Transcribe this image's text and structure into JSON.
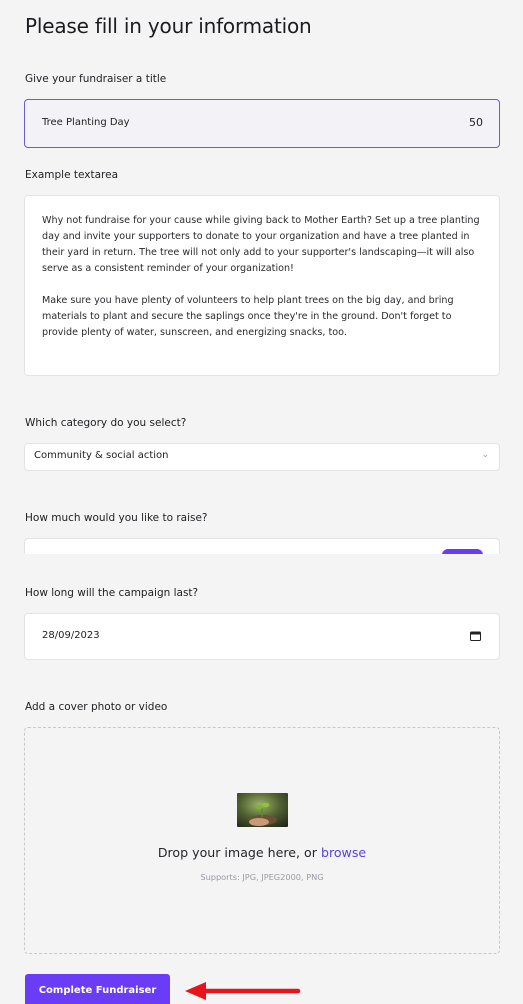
{
  "page": {
    "title": "Please fill in your information"
  },
  "title_field": {
    "label": "Give your fundraiser a title",
    "value": "Tree Planting Day",
    "char_count": "50"
  },
  "textarea_field": {
    "label": "Example textarea",
    "paragraph_1": "Why not fundraise for your cause while giving back to Mother Earth? Set up a tree planting day and invite your supporters to donate to your organization and have a tree planted in their yard in return. The tree will not only add to your supporter's landscaping—it will also serve as a consistent reminder of your organization!",
    "paragraph_2": "Make sure you have plenty of volunteers to help plant trees on the big day, and bring materials to plant and secure the saplings once they're in the ground. Don't forget to provide plenty of water, sunscreen, and energizing snacks, too."
  },
  "category_field": {
    "label": "Which category do you select?",
    "value": "Community & social action",
    "icon": "chevron-down-icon"
  },
  "amount_field": {
    "label": "How much would you like to raise?"
  },
  "duration_field": {
    "label": "How long will the campaign last?",
    "value": "28/09/2023",
    "icon": "calendar-icon"
  },
  "media_field": {
    "label": "Add a cover photo or video",
    "drop_text": "Drop your image here, or",
    "browse_link": "browse",
    "supports": "Supports: JPG, JPEG2000, PNG"
  },
  "submit_button": {
    "label": "Complete Fundraiser"
  },
  "colors": {
    "accent": "#6b3cf5",
    "focus_border": "#6d5bd0",
    "link": "#5b3fe0",
    "arrow": "#e8141b",
    "background": "#f4f4f5"
  }
}
